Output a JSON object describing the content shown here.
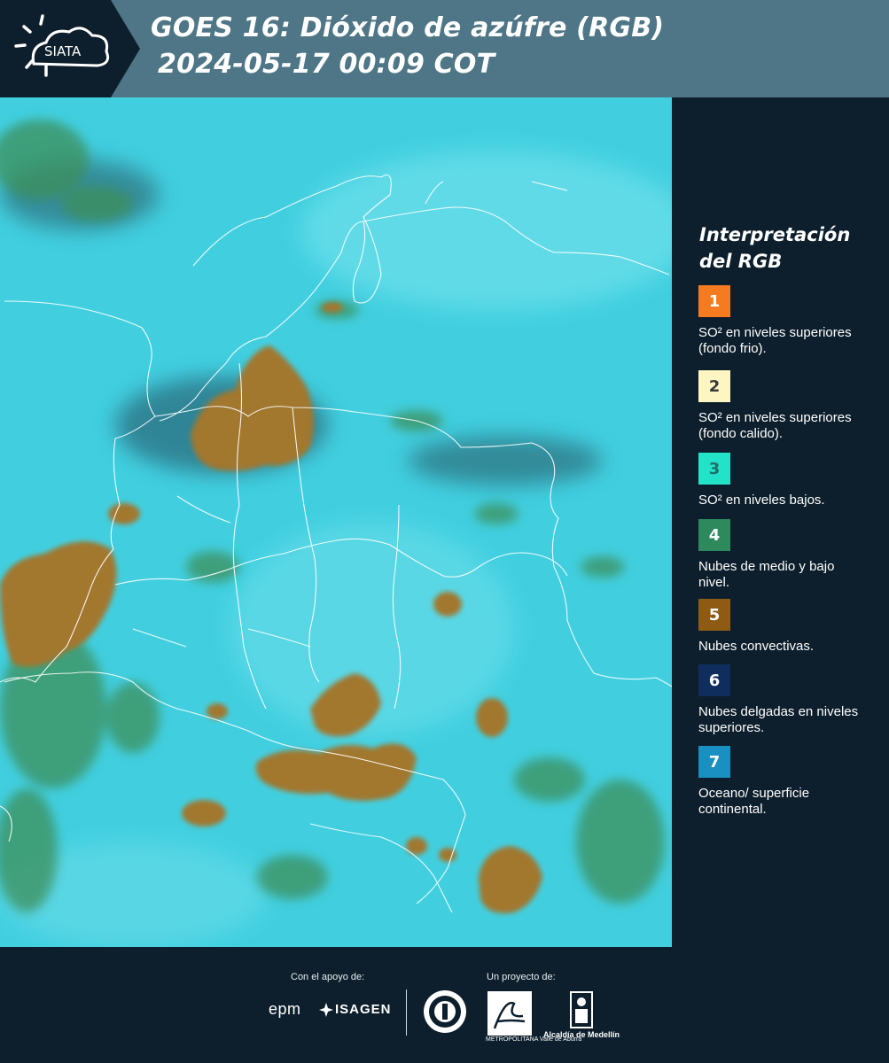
{
  "header": {
    "logo_text": "SIATA",
    "title_line1": "GOES 16: Dióxido de azúfre (RGB)",
    "title_line2": "2024-05-17 00:09 COT"
  },
  "legend": {
    "title": "Interpretación del RGB",
    "items": [
      {
        "number": "1",
        "label": "SO² en niveles superiores (fondo frio).",
        "color": "#f47b20",
        "number_color": "#ffffff"
      },
      {
        "number": "2",
        "label": "SO² en niveles superiores (fondo calido).",
        "color": "#fdf6c3",
        "number_color": "#3a3a3a"
      },
      {
        "number": "3",
        "label": "SO² en niveles bajos.",
        "color": "#22e3c8",
        "number_color": "#1e6e6a"
      },
      {
        "number": "4",
        "label": "Nubes de medio y bajo nivel.",
        "color": "#2e8a5c",
        "number_color": "#ffffff"
      },
      {
        "number": "5",
        "label": "Nubes convectivas.",
        "color": "#8e5a14",
        "number_color": "#ffffff"
      },
      {
        "number": "6",
        "label": "Nubes delgadas en niveles superiores.",
        "color": "#0f2e5e",
        "number_color": "#ffffff"
      },
      {
        "number": "7",
        "label": "Oceano/ superficie continental.",
        "color": "#1a8fc1",
        "number_color": "#ffffff"
      }
    ]
  },
  "map": {
    "background_color": "#41cfe0",
    "convective_color": "#a2772f",
    "green_cloud_color": "#3c8f5a",
    "border_color": "#ffffff"
  },
  "footer": {
    "support_label": "Con el apoyo de:",
    "project_label": "Un proyecto de:",
    "sponsor1": "epm",
    "sponsor2": "ISAGEN",
    "area_text": "METROPOLITANA Valle de Aburrá",
    "alcaldia_text": "Alcaldía de Medellín"
  }
}
